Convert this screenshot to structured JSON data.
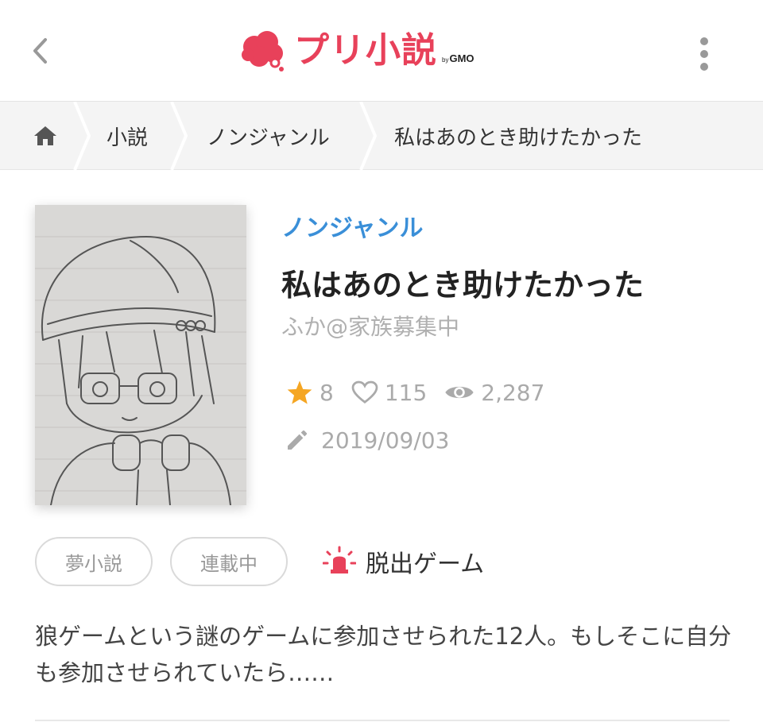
{
  "header": {
    "logo_text": "プリ小説",
    "logo_by": "by",
    "logo_gmo": "GMO",
    "brand_color": "#e8415a"
  },
  "breadcrumb": {
    "home_icon": "home-icon",
    "items": [
      "小説",
      "ノンジャンル",
      "私はあのとき助けたかった"
    ]
  },
  "novel": {
    "genre": "ノンジャンル",
    "title": "私はあのとき助けたかった",
    "author": "ふか@家族募集中",
    "stars": "8",
    "likes": "115",
    "views": "2,287",
    "date": "2019/09/03",
    "tags": [
      "夢小説",
      "連載中"
    ],
    "special_tag": "脱出ゲーム",
    "description": "狼ゲームという謎のゲームに参加させられた12人。もしそこに自分も参加させられていたら‥‥‥"
  },
  "colors": {
    "genre_link": "#3a8fd8",
    "star": "#f5a623",
    "special_tag_icon": "#e8415a"
  }
}
